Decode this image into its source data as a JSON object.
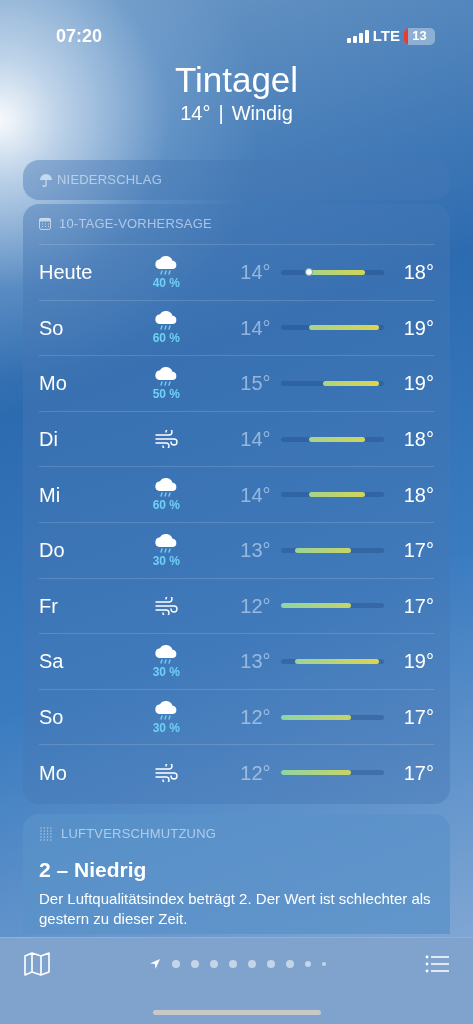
{
  "status_bar": {
    "time": "07:20",
    "network": "LTE",
    "battery": "13"
  },
  "header": {
    "city": "Tintagel",
    "temperature": "14°",
    "separator": "|",
    "condition": "Windig"
  },
  "precipitation": {
    "title": "NIEDERSCHLAG"
  },
  "forecast": {
    "title": "10-TAGE-VORHERSAGE",
    "days": [
      {
        "day": "Heute",
        "kind": "rain",
        "chance": "40 %",
        "low": "14°",
        "high": "18°",
        "now_marker": true
      },
      {
        "day": "So",
        "kind": "rain",
        "chance": "60 %",
        "low": "14°",
        "high": "19°",
        "now_marker": false
      },
      {
        "day": "Mo",
        "kind": "rain",
        "chance": "50 %",
        "low": "15°",
        "high": "19°",
        "now_marker": false
      },
      {
        "day": "Di",
        "kind": "wind",
        "low": "14°",
        "high": "18°",
        "now_marker": false
      },
      {
        "day": "Mi",
        "kind": "rain",
        "chance": "60 %",
        "low": "14°",
        "high": "18°",
        "now_marker": false
      },
      {
        "day": "Do",
        "kind": "rain",
        "chance": "30 %",
        "low": "13°",
        "high": "17°",
        "now_marker": false
      },
      {
        "day": "Fr",
        "kind": "wind",
        "low": "12°",
        "high": "17°",
        "now_marker": false
      },
      {
        "day": "Sa",
        "kind": "rain",
        "chance": "30 %",
        "low": "13°",
        "high": "19°",
        "now_marker": false
      },
      {
        "day": "So",
        "kind": "rain",
        "chance": "30 %",
        "low": "12°",
        "high": "17°",
        "now_marker": false
      },
      {
        "day": "Mo",
        "kind": "wind",
        "low": "12°",
        "high": "17°",
        "now_marker": false
      }
    ]
  },
  "air_quality": {
    "title": "LUFTVERSCHMUTZUNG",
    "value": "2 – Niedrig",
    "description": "Der Luftqualitätsindex beträgt 2. Der Wert ist schlechter als gestern zu dieser Zeit."
  },
  "pages": [
    {
      "kind": "location",
      "selected": true
    },
    {
      "kind": "city",
      "selected": false
    },
    {
      "kind": "city",
      "selected": false
    },
    {
      "kind": "city",
      "selected": false
    },
    {
      "kind": "city",
      "selected": false
    },
    {
      "kind": "city",
      "selected": false
    },
    {
      "kind": "city",
      "selected": false
    },
    {
      "kind": "city",
      "selected": false
    },
    {
      "kind": "more",
      "selected": false
    },
    {
      "kind": "more-small",
      "selected": false
    }
  ]
}
